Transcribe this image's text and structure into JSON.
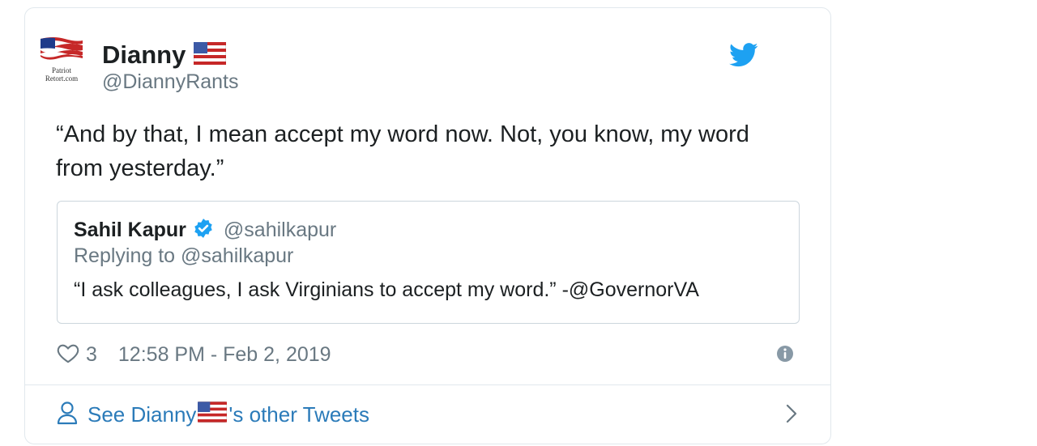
{
  "author": {
    "name": "Dianny",
    "handle": "@DiannyRants",
    "avatar_text_1": "Patriot",
    "avatar_text_2": "Retort.com"
  },
  "tweet": {
    "text_line_1": "“And by that, I mean accept my word now. Not, you know, my word",
    "text_line_2": "from yesterday.”",
    "likes": "3",
    "timestamp": "12:58 PM - Feb 2, 2019"
  },
  "quoted_tweet": {
    "name": "Sahil Kapur",
    "handle": "@sahilkapur",
    "replying_to": "Replying to @sahilkapur",
    "text": "“I ask colleagues, I ask Virginians to accept my word.” -@GovernorVA"
  },
  "footer": {
    "prefix": "See Dianny",
    "suffix": "'s other Tweets"
  },
  "colors": {
    "twitter_blue": "#1da1f2",
    "link_blue": "#2b7bb9",
    "muted_gray": "#697882",
    "border": "#e1e8ed"
  },
  "icons": [
    "twitter-bird-icon",
    "us-flag-icon",
    "verified-badge-icon",
    "heart-icon",
    "info-icon",
    "person-icon",
    "chevron-right-icon"
  ]
}
